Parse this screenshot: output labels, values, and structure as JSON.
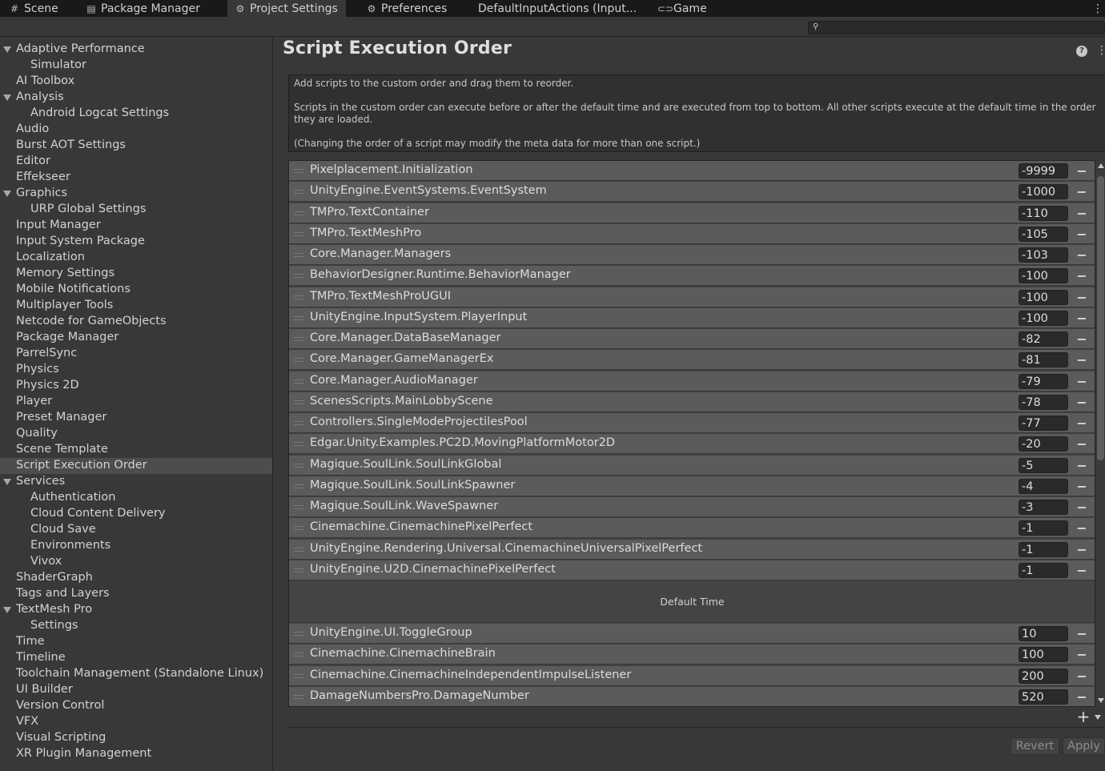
{
  "tabs": [
    {
      "label": "Scene",
      "icon": "hash-icon",
      "glyph": "#"
    },
    {
      "label": "Package Manager",
      "icon": "package-icon",
      "glyph": "▤"
    },
    {
      "label": "Project Settings",
      "icon": "gear-icon",
      "glyph": "⚙"
    },
    {
      "label": "Preferences",
      "icon": "gear-icon",
      "glyph": "⚙"
    },
    {
      "label": "DefaultInputActions (Input...",
      "icon": "",
      "glyph": ""
    },
    {
      "label": "Game",
      "icon": "gamepad-icon",
      "glyph": "🎮"
    }
  ],
  "search": {
    "placeholder": "",
    "value": ""
  },
  "sidebar": {
    "selected": "Script Execution Order",
    "items": [
      {
        "label": "Adaptive Performance",
        "level": 0,
        "expanded": true
      },
      {
        "label": "Simulator",
        "level": 1
      },
      {
        "label": "AI Toolbox",
        "level": 0
      },
      {
        "label": "Analysis",
        "level": 0,
        "expanded": true
      },
      {
        "label": "Android Logcat Settings",
        "level": 1
      },
      {
        "label": "Audio",
        "level": 0
      },
      {
        "label": "Burst AOT Settings",
        "level": 0
      },
      {
        "label": "Editor",
        "level": 0
      },
      {
        "label": "Effekseer",
        "level": 0
      },
      {
        "label": "Graphics",
        "level": 0,
        "expanded": true
      },
      {
        "label": "URP Global Settings",
        "level": 1
      },
      {
        "label": "Input Manager",
        "level": 0
      },
      {
        "label": "Input System Package",
        "level": 0
      },
      {
        "label": "Localization",
        "level": 0
      },
      {
        "label": "Memory Settings",
        "level": 0
      },
      {
        "label": "Mobile Notifications",
        "level": 0
      },
      {
        "label": "Multiplayer Tools",
        "level": 0
      },
      {
        "label": "Netcode for GameObjects",
        "level": 0
      },
      {
        "label": "Package Manager",
        "level": 0
      },
      {
        "label": "ParrelSync",
        "level": 0
      },
      {
        "label": "Physics",
        "level": 0
      },
      {
        "label": "Physics 2D",
        "level": 0
      },
      {
        "label": "Player",
        "level": 0
      },
      {
        "label": "Preset Manager",
        "level": 0
      },
      {
        "label": "Quality",
        "level": 0
      },
      {
        "label": "Scene Template",
        "level": 0
      },
      {
        "label": "Script Execution Order",
        "level": 0
      },
      {
        "label": "Services",
        "level": 0,
        "expanded": true
      },
      {
        "label": "Authentication",
        "level": 1
      },
      {
        "label": "Cloud Content Delivery",
        "level": 1
      },
      {
        "label": "Cloud Save",
        "level": 1
      },
      {
        "label": "Environments",
        "level": 1
      },
      {
        "label": "Vivox",
        "level": 1
      },
      {
        "label": "ShaderGraph",
        "level": 0
      },
      {
        "label": "Tags and Layers",
        "level": 0
      },
      {
        "label": "TextMesh Pro",
        "level": 0,
        "expanded": true
      },
      {
        "label": "Settings",
        "level": 1
      },
      {
        "label": "Time",
        "level": 0
      },
      {
        "label": "Timeline",
        "level": 0
      },
      {
        "label": "Toolchain Management (Standalone Linux)",
        "level": 0
      },
      {
        "label": "UI Builder",
        "level": 0
      },
      {
        "label": "Version Control",
        "level": 0
      },
      {
        "label": "VFX",
        "level": 0
      },
      {
        "label": "Visual Scripting",
        "level": 0
      },
      {
        "label": "XR Plugin Management",
        "level": 0
      }
    ]
  },
  "main": {
    "title": "Script Execution Order",
    "help_icon": "?",
    "menu_icon": "⋮",
    "help_text": {
      "line1": "Add scripts to the custom order and drag them to reorder.",
      "line2": "Scripts in the custom order can execute before or after the default time and are executed from top to bottom. All other scripts execute at the default time in the order they are loaded.",
      "line3": "(Changing the order of a script may modify the meta data for more than one script.)"
    },
    "before_default": [
      {
        "name": "Pixelplacement.Initialization",
        "order": "-9999"
      },
      {
        "name": "UnityEngine.EventSystems.EventSystem",
        "order": "-1000"
      },
      {
        "name": "TMPro.TextContainer",
        "order": "-110"
      },
      {
        "name": "TMPro.TextMeshPro",
        "order": "-105"
      },
      {
        "name": "Core.Manager.Managers",
        "order": "-103"
      },
      {
        "name": "BehaviorDesigner.Runtime.BehaviorManager",
        "order": "-100"
      },
      {
        "name": "TMPro.TextMeshProUGUI",
        "order": "-100"
      },
      {
        "name": "UnityEngine.InputSystem.PlayerInput",
        "order": "-100"
      },
      {
        "name": "Core.Manager.DataBaseManager",
        "order": "-82"
      },
      {
        "name": "Core.Manager.GameManagerEx",
        "order": "-81"
      },
      {
        "name": "Core.Manager.AudioManager",
        "order": "-79"
      },
      {
        "name": "ScenesScripts.MainLobbyScene",
        "order": "-78"
      },
      {
        "name": "Controllers.SingleModeProjectilesPool",
        "order": "-77"
      },
      {
        "name": "Edgar.Unity.Examples.PC2D.MovingPlatformMotor2D",
        "order": "-20"
      },
      {
        "name": "Magique.SoulLink.SoulLinkGlobal",
        "order": "-5"
      },
      {
        "name": "Magique.SoulLink.SoulLinkSpawner",
        "order": "-4"
      },
      {
        "name": "Magique.SoulLink.WaveSpawner",
        "order": "-3"
      },
      {
        "name": "Cinemachine.CinemachinePixelPerfect",
        "order": "-1"
      },
      {
        "name": "UnityEngine.Rendering.Universal.CinemachineUniversalPixelPerfect",
        "order": "-1"
      },
      {
        "name": "UnityEngine.U2D.CinemachinePixelPerfect",
        "order": "-1"
      }
    ],
    "default_time_label": "Default Time",
    "after_default": [
      {
        "name": "UnityEngine.UI.ToggleGroup",
        "order": "10"
      },
      {
        "name": "Cinemachine.CinemachineBrain",
        "order": "100"
      },
      {
        "name": "Cinemachine.CinemachineIndependentImpulseListener",
        "order": "200"
      },
      {
        "name": "DamageNumbersPro.DamageNumber",
        "order": "520"
      }
    ],
    "remove_glyph": "−",
    "add_glyph": "+",
    "revert_label": "Revert",
    "apply_label": "Apply"
  }
}
